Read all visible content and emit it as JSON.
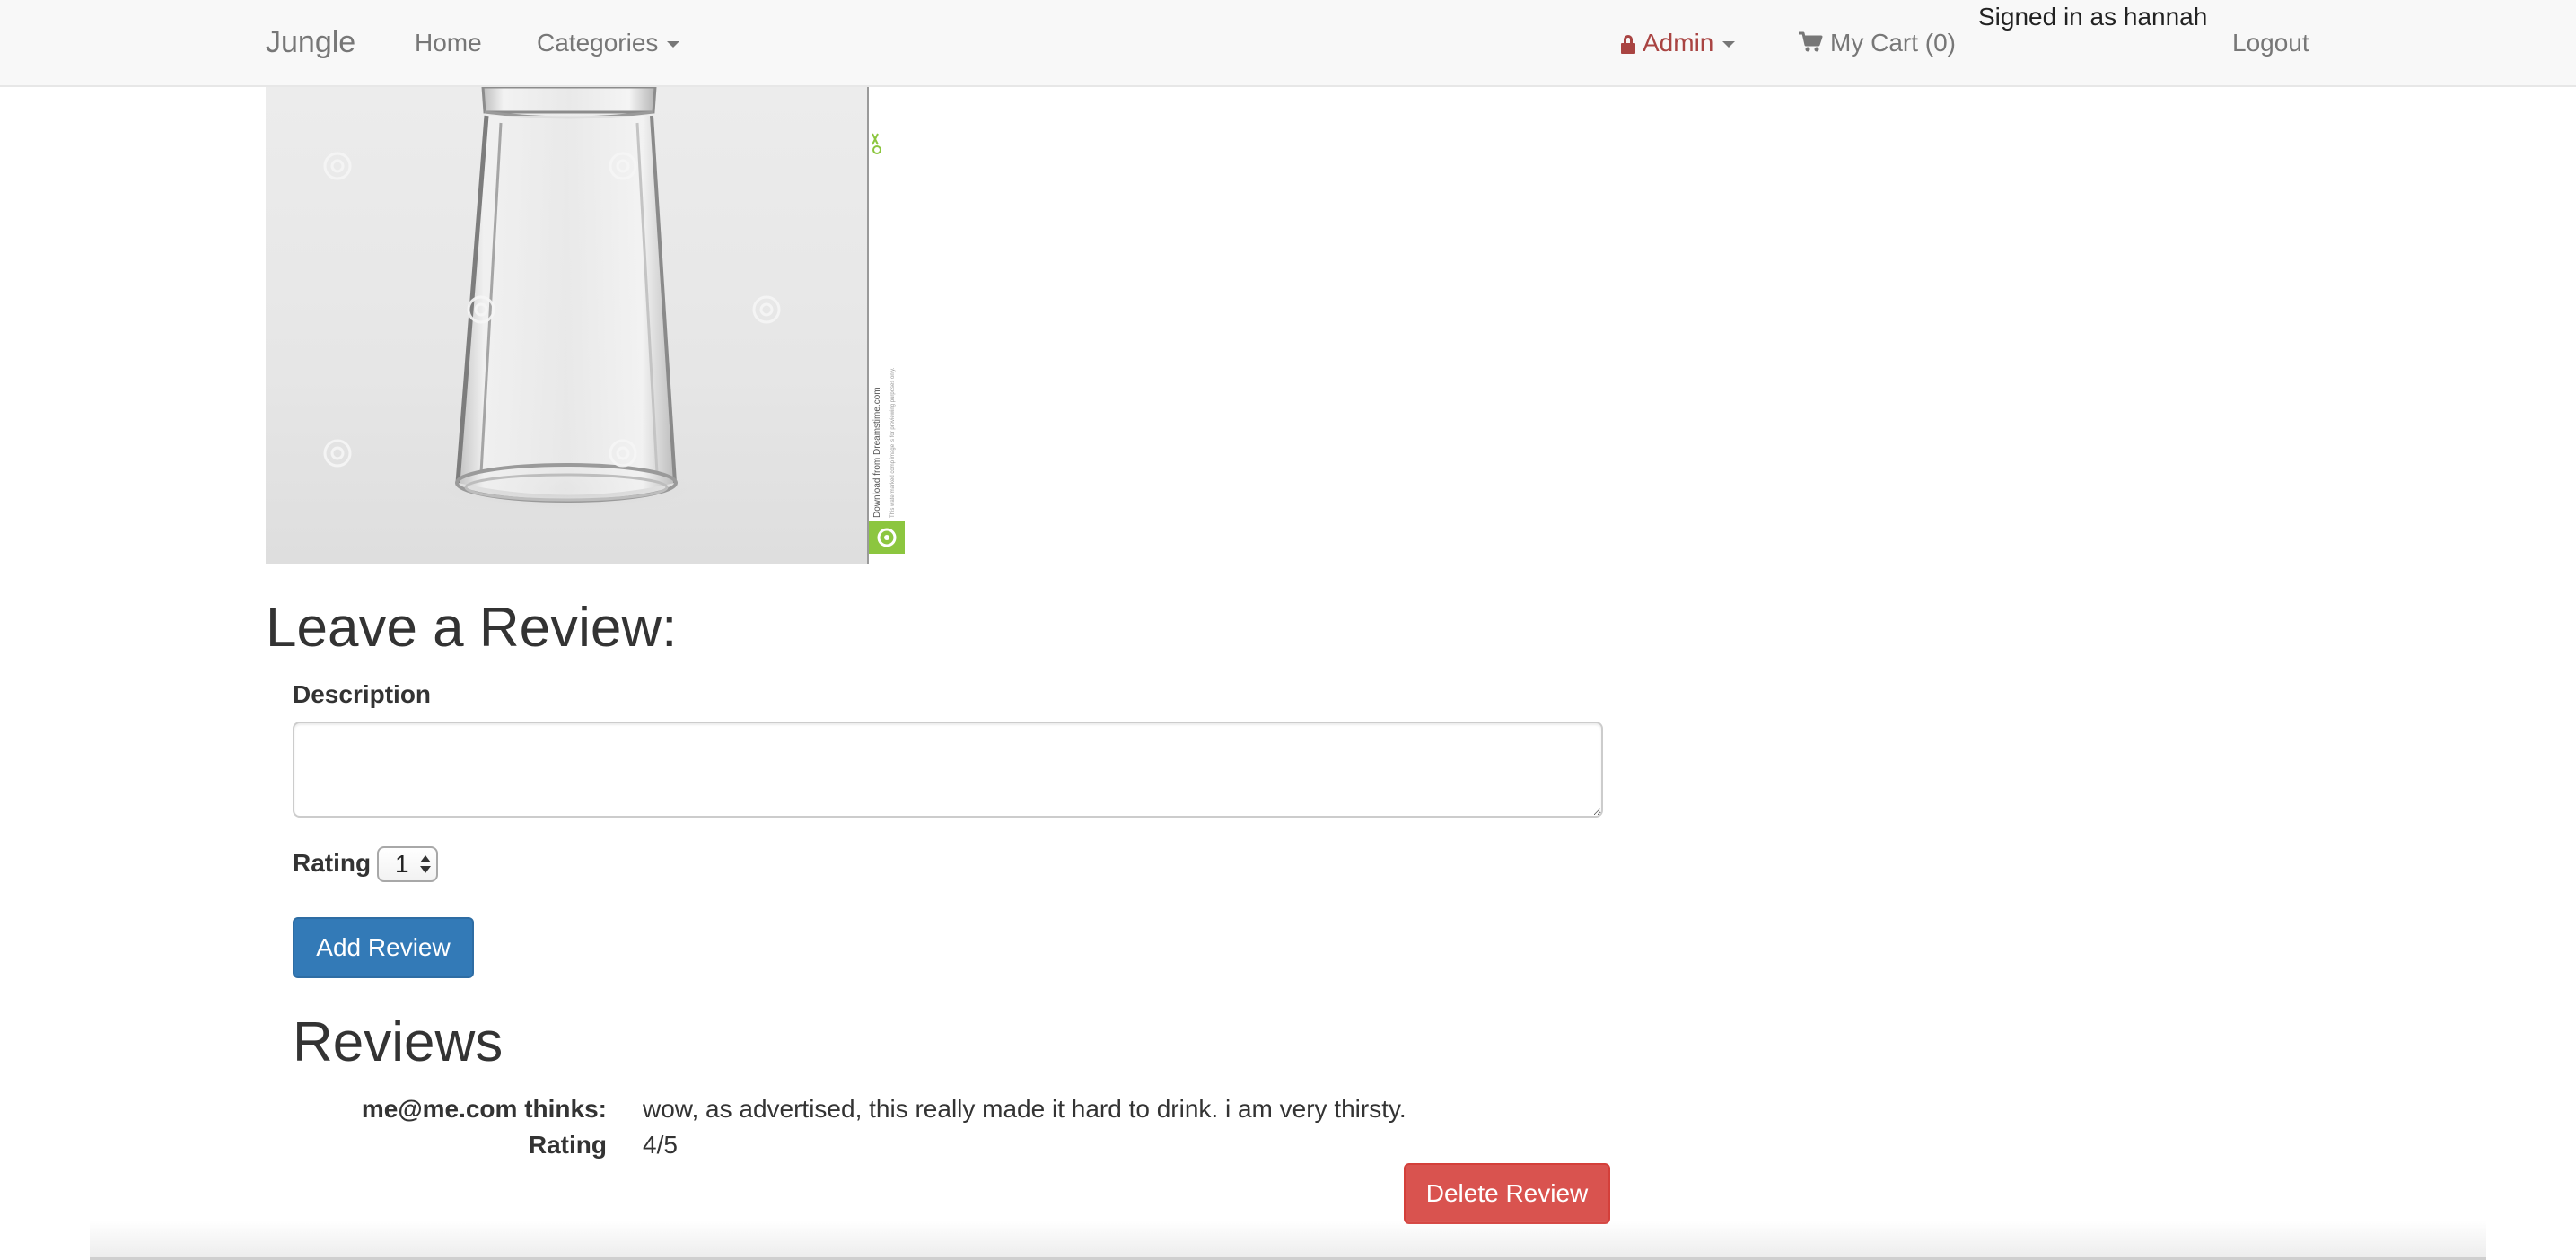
{
  "navbar": {
    "brand": "Jungle",
    "home": "Home",
    "categories": "Categories",
    "admin": "Admin",
    "cart": "My Cart (0)",
    "signed_in": "Signed in as hannah",
    "logout": "Logout"
  },
  "product": {
    "image_watermark": "Download from Dreamstime.com",
    "image_watermark_sub": "This watermarked comp image is for previewing purposes only."
  },
  "review_form": {
    "title": "Leave a Review:",
    "description_label": "Description",
    "description_value": "",
    "rating_label": "Rating",
    "rating_selected": "1",
    "submit_label": "Add Review"
  },
  "reviews": {
    "title": "Reviews",
    "items": [
      {
        "author_label": "me@me.com thinks:",
        "text": "wow, as advertised, this really made it hard to drink. i am very thirsty.",
        "rating_label": "Rating",
        "rating_value": "4/5",
        "delete_label": "Delete Review"
      }
    ]
  },
  "colors": {
    "navbar_bg": "#f8f8f8",
    "admin_red": "#a94442",
    "primary_blue": "#337ab7",
    "danger_red": "#d9534f",
    "watermark_green": "#8cc63f"
  }
}
